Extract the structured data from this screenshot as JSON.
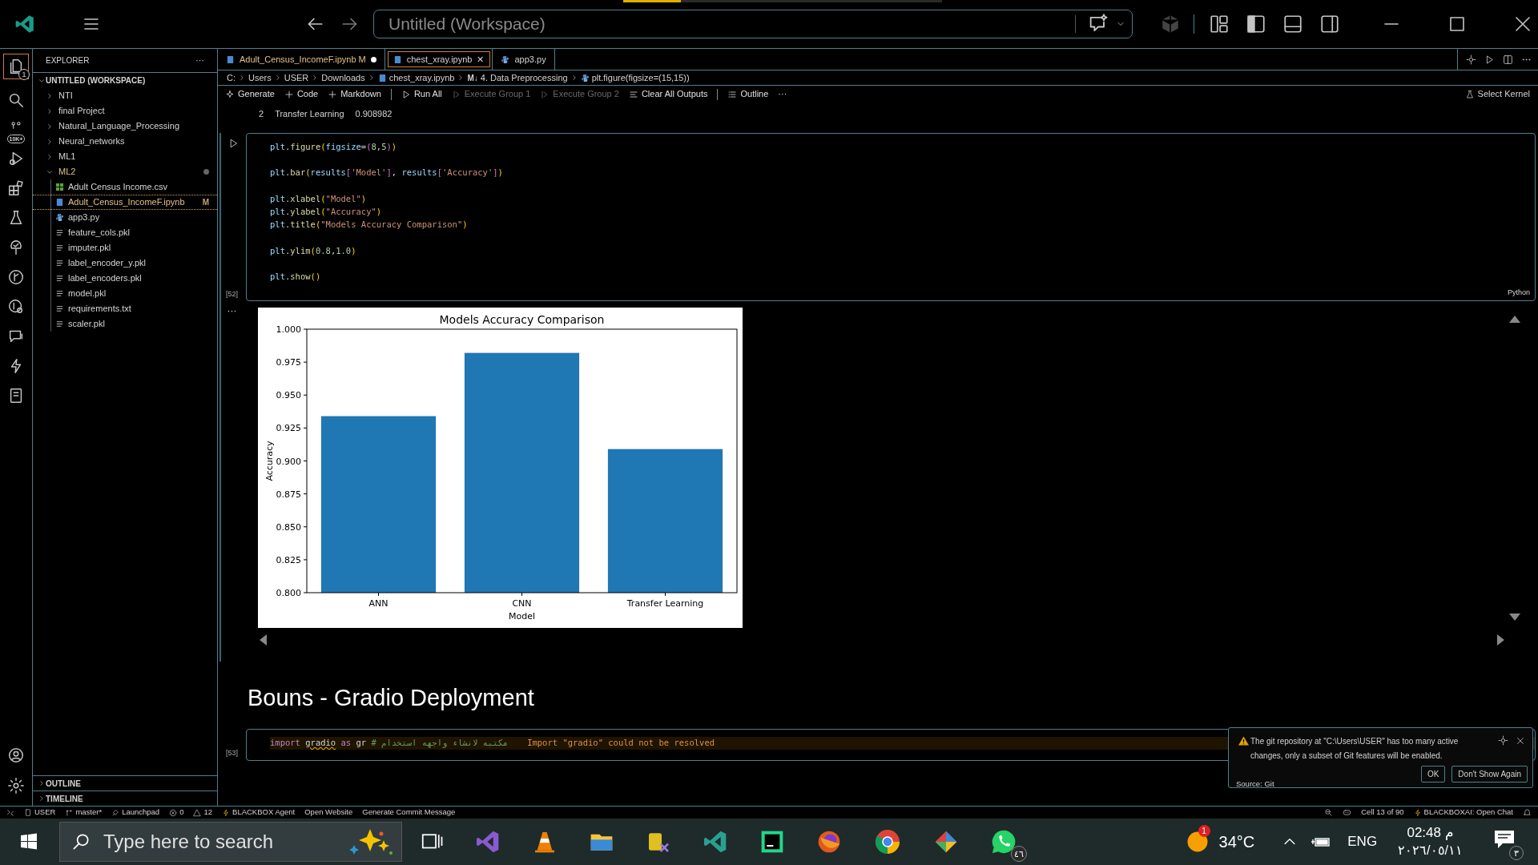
{
  "window": {
    "title": "Untitled (Workspace)"
  },
  "activity_bar": {
    "explorer_badge": "1",
    "source_control_badge": "10K+"
  },
  "sidebar": {
    "title": "EXPLORER",
    "more": "···",
    "workspace": "UNTITLED (WORKSPACE)",
    "items": [
      {
        "label": "NTI",
        "kind": "folder",
        "expanded": false,
        "selected": false
      },
      {
        "label": "final Project",
        "kind": "folder",
        "expanded": false,
        "selected": false
      },
      {
        "label": "Natural_Language_Processing",
        "kind": "folder",
        "expanded": false,
        "selected": false
      },
      {
        "label": "Neural_networks",
        "kind": "folder",
        "expanded": false,
        "selected": false
      },
      {
        "label": "ML1",
        "kind": "folder",
        "expanded": false,
        "selected": false
      },
      {
        "label": "ML2",
        "kind": "folder",
        "expanded": true,
        "selected": false,
        "modified": true,
        "children": [
          {
            "label": "Adult Census Income.csv",
            "kind": "csv",
            "selected": false
          },
          {
            "label": "Adult_Census_IncomeF.ipynb",
            "kind": "notebook",
            "selected": true,
            "badge": "M"
          },
          {
            "label": "app3.py",
            "kind": "python",
            "selected": false
          },
          {
            "label": "feature_cols.pkl",
            "kind": "text",
            "selected": false
          },
          {
            "label": "imputer.pkl",
            "kind": "text",
            "selected": false
          },
          {
            "label": "label_encoder_y.pkl",
            "kind": "text",
            "selected": false
          },
          {
            "label": "label_encoders.pkl",
            "kind": "text",
            "selected": false
          },
          {
            "label": "model.pkl",
            "kind": "text",
            "selected": false
          },
          {
            "label": "requirements.txt",
            "kind": "text",
            "selected": false
          },
          {
            "label": "scaler.pkl",
            "kind": "text",
            "selected": false
          }
        ]
      }
    ],
    "sections": [
      {
        "label": "OUTLINE"
      },
      {
        "label": "TIMELINE"
      }
    ]
  },
  "tabs": [
    {
      "label": "Adult_Census_IncomeF.ipynb",
      "kind": "notebook",
      "selected": false,
      "badge": "M",
      "dirty": true
    },
    {
      "label": "chest_xray.ipynb",
      "kind": "notebook",
      "selected": true,
      "close": "✕"
    },
    {
      "label": "app3.py",
      "kind": "python",
      "selected": false
    }
  ],
  "breadcrumb": [
    {
      "label": "C:",
      "kind": "plain"
    },
    {
      "label": "Users",
      "kind": "plain"
    },
    {
      "label": "USER",
      "kind": "plain"
    },
    {
      "label": "Downloads",
      "kind": "plain"
    },
    {
      "label": "chest_xray.ipynb",
      "kind": "notebook"
    },
    {
      "label": "4. Data Preprocessing",
      "kind": "markdown",
      "icon_text": "M↓"
    },
    {
      "label": "plt.figure(figsize=(15,15))",
      "kind": "python"
    }
  ],
  "toolbar": [
    {
      "label": "Generate",
      "kind": "sparkle",
      "disabled": false
    },
    {
      "label": "Code",
      "kind": "plus",
      "disabled": false
    },
    {
      "label": "Markdown",
      "kind": "plus",
      "disabled": false
    },
    {
      "label": "Run All",
      "kind": "run",
      "disabled": false
    },
    {
      "label": "Execute Group 1",
      "kind": "group",
      "disabled": true
    },
    {
      "label": "Execute Group 2",
      "kind": "group",
      "disabled": true
    },
    {
      "label": "Clear All Outputs",
      "kind": "clear",
      "disabled": false
    },
    {
      "label": "Outline",
      "kind": "list",
      "disabled": false
    }
  ],
  "toolbar_more": "···",
  "kernel": "Select Kernel",
  "prev_output": [
    "2",
    "Transfer Learning",
    "0.908982"
  ],
  "cell": {
    "count": "[52]",
    "language": "Python",
    "blocks": [
      [
        [
          {
            "kind": "var",
            "text": "plt"
          },
          {
            "kind": "plain",
            "text": "."
          },
          {
            "kind": "func",
            "text": "figure"
          },
          {
            "kind": "paren",
            "text": "("
          },
          {
            "kind": "var",
            "text": "figsize"
          },
          {
            "kind": "plain",
            "text": "="
          },
          {
            "kind": "paren2",
            "text": "("
          },
          {
            "kind": "num",
            "text": "8"
          },
          {
            "kind": "plain",
            "text": ","
          },
          {
            "kind": "num",
            "text": "5"
          },
          {
            "kind": "paren2",
            "text": ")"
          },
          {
            "kind": "paren",
            "text": ")"
          }
        ]
      ],
      [
        [
          {
            "kind": "var",
            "text": "plt"
          },
          {
            "kind": "plain",
            "text": "."
          },
          {
            "kind": "func",
            "text": "bar"
          },
          {
            "kind": "paren",
            "text": "("
          },
          {
            "kind": "var",
            "text": "results"
          },
          {
            "kind": "paren2",
            "text": "["
          },
          {
            "kind": "str",
            "text": "'Model'"
          },
          {
            "kind": "paren2",
            "text": "]"
          },
          {
            "kind": "plain",
            "text": ", "
          },
          {
            "kind": "var",
            "text": "results"
          },
          {
            "kind": "paren2",
            "text": "["
          },
          {
            "kind": "str",
            "text": "'Accuracy'"
          },
          {
            "kind": "paren2",
            "text": "]"
          },
          {
            "kind": "paren",
            "text": ")"
          }
        ]
      ],
      [
        [
          {
            "kind": "var",
            "text": "plt"
          },
          {
            "kind": "plain",
            "text": "."
          },
          {
            "kind": "func",
            "text": "xlabel"
          },
          {
            "kind": "paren",
            "text": "("
          },
          {
            "kind": "str",
            "text": "\"Model\""
          },
          {
            "kind": "paren",
            "text": ")"
          }
        ],
        [
          {
            "kind": "var",
            "text": "plt"
          },
          {
            "kind": "plain",
            "text": "."
          },
          {
            "kind": "func",
            "text": "ylabel"
          },
          {
            "kind": "paren",
            "text": "("
          },
          {
            "kind": "str",
            "text": "\"Accuracy\""
          },
          {
            "kind": "paren",
            "text": ")"
          }
        ],
        [
          {
            "kind": "var",
            "text": "plt"
          },
          {
            "kind": "plain",
            "text": "."
          },
          {
            "kind": "func",
            "text": "title"
          },
          {
            "kind": "paren",
            "text": "("
          },
          {
            "kind": "str",
            "text": "\"Models Accuracy Comparison\""
          },
          {
            "kind": "paren",
            "text": ")"
          }
        ]
      ],
      [
        [
          {
            "kind": "var",
            "text": "plt"
          },
          {
            "kind": "plain",
            "text": "."
          },
          {
            "kind": "func",
            "text": "ylim"
          },
          {
            "kind": "paren",
            "text": "("
          },
          {
            "kind": "num",
            "text": "0.8"
          },
          {
            "kind": "plain",
            "text": ","
          },
          {
            "kind": "num",
            "text": "1.0"
          },
          {
            "kind": "paren",
            "text": ")"
          }
        ]
      ],
      [
        [
          {
            "kind": "var",
            "text": "plt"
          },
          {
            "kind": "plain",
            "text": "."
          },
          {
            "kind": "func",
            "text": "show"
          },
          {
            "kind": "paren",
            "text": "()"
          }
        ]
      ]
    ]
  },
  "output": {
    "more": "···",
    "chart_data": {
      "type": "bar",
      "title": "Models Accuracy Comparison",
      "xlabel": "Model",
      "ylabel": "Accuracy",
      "categories": [
        "ANN",
        "CNN",
        "Transfer Learning"
      ],
      "series": [
        {
          "color": "#1f77b4",
          "values": [
            0.934,
            0.982,
            0.909
          ]
        }
      ],
      "ylim": [
        0.8,
        1.0
      ],
      "yticks": [
        {
          "value": 0.8,
          "label": "0.800"
        },
        {
          "value": 0.825,
          "label": "0.825"
        },
        {
          "value": 0.85,
          "label": "0.850"
        },
        {
          "value": 0.875,
          "label": "0.875"
        },
        {
          "value": 0.9,
          "label": "0.900"
        },
        {
          "value": 0.925,
          "label": "0.925"
        },
        {
          "value": 0.95,
          "label": "0.950"
        },
        {
          "value": 0.975,
          "label": "0.975"
        },
        {
          "value": 1.0,
          "label": "1.000"
        }
      ]
    }
  },
  "heading": "Bouns - Gradio Deployment",
  "cell2": {
    "count": "[53]",
    "line": [
      {
        "kind": "kw",
        "text": "import "
      },
      {
        "kind": "unresolved",
        "text": "gradio"
      },
      {
        "kind": "kw",
        "text": " as"
      },
      {
        "kind": "plain",
        "text": " gr"
      },
      {
        "kind": "comment",
        "text": " # مكتبه لانشاء واجهه استخدام"
      }
    ],
    "error": "Import \"gradio\" could not be resolved"
  },
  "notification": {
    "message": "The git repository at \"C:\\Users\\USER\" has too many active changes, only a subset of Git features will be enabled.",
    "source": "Source: Git",
    "buttons": [
      "OK",
      "Don't Show Again"
    ]
  },
  "status_bar": {
    "left": [
      {
        "kind": "user",
        "label": "USER"
      },
      {
        "kind": "branch",
        "label": "master*"
      },
      {
        "kind": "launch",
        "label": "Launchpad"
      },
      {
        "kind": "errors",
        "label": "0"
      },
      {
        "kind": "warnings",
        "label": "12"
      },
      {
        "kind": "bolt",
        "label": "BLACKBOX Agent"
      },
      {
        "kind": "plain",
        "label": "Open Website"
      },
      {
        "kind": "plain",
        "label": "Generate Commit Message"
      }
    ],
    "right": [
      {
        "kind": "plain",
        "label": "Cell 13 of 90"
      },
      {
        "kind": "bolt",
        "label": "BLACKBOXAI: Open Chat"
      }
    ]
  },
  "taskbar": {
    "search_placeholder": "Type here to search",
    "weather_badge": "1",
    "temperature": "34°C",
    "language": "ENG",
    "time": "02:48 م",
    "date": "٢٠٢٦/٠٥/١١",
    "whatsapp_badge": "٤٦",
    "notifications_badge": "٣"
  }
}
